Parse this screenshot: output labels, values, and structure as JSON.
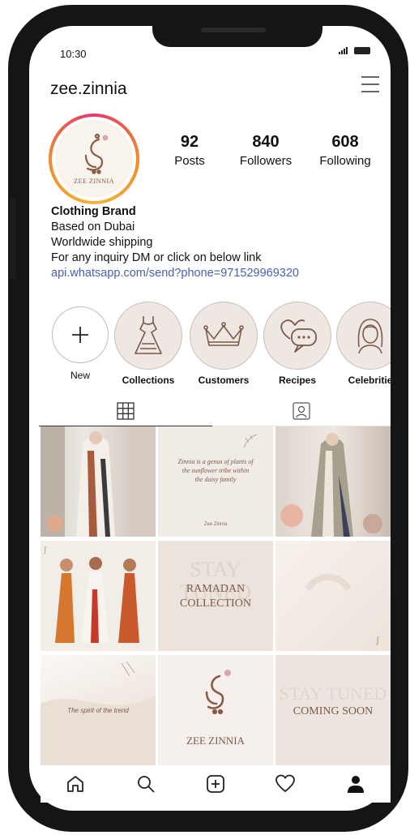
{
  "status_bar": {
    "time": "10:30"
  },
  "profile": {
    "username": "zee.zinnia",
    "avatar_text": "ZEE ZINNIA",
    "stats": [
      {
        "value": "92",
        "label": "Posts"
      },
      {
        "value": "840",
        "label": "Followers"
      },
      {
        "value": "608",
        "label": "Following"
      }
    ],
    "bio": {
      "name": "Clothing Brand",
      "lines": [
        "Based on Dubai",
        "Worldwide shipping",
        "For any inquiry DM or click on below link"
      ],
      "link": "api.whatsapp.com/send?phone=971529969320"
    }
  },
  "highlights": [
    {
      "label": "New",
      "icon": "plus-icon"
    },
    {
      "label": "Collections",
      "icon": "dress-icon"
    },
    {
      "label": "Customers",
      "icon": "crown-icon"
    },
    {
      "label": "Recipes",
      "icon": "heart-chat-icon"
    },
    {
      "label": "Celebritie",
      "icon": "woman-icon"
    }
  ],
  "tabs": [
    {
      "name": "grid",
      "icon": "grid-icon",
      "active": true
    },
    {
      "name": "tagged",
      "icon": "tagged-icon",
      "active": false
    }
  ],
  "posts": {
    "quote_1": "Zinnia is a genus of plants of the sunflower tribe within the daisy family",
    "quote_1_brand": "Zee Zinnia",
    "ramadan_line1": "RAMADAN",
    "ramadan_line2": "COLLECTION",
    "ramadan_bg": "STAY TUNED",
    "trend_text": "The spirit of the trend",
    "logo_text": "ZEE ZINNIA",
    "coming_soon": "COMING SOON",
    "coming_bg": "STAY TUNED"
  },
  "bottom_nav": [
    "home-icon",
    "search-icon",
    "add-post-icon",
    "activity-heart-icon",
    "profile-icon"
  ],
  "colors": {
    "link": "#4a5fae",
    "ring_start": "#e8376d",
    "ring_end": "#f6b338",
    "brand_brown": "#8a5b45"
  }
}
